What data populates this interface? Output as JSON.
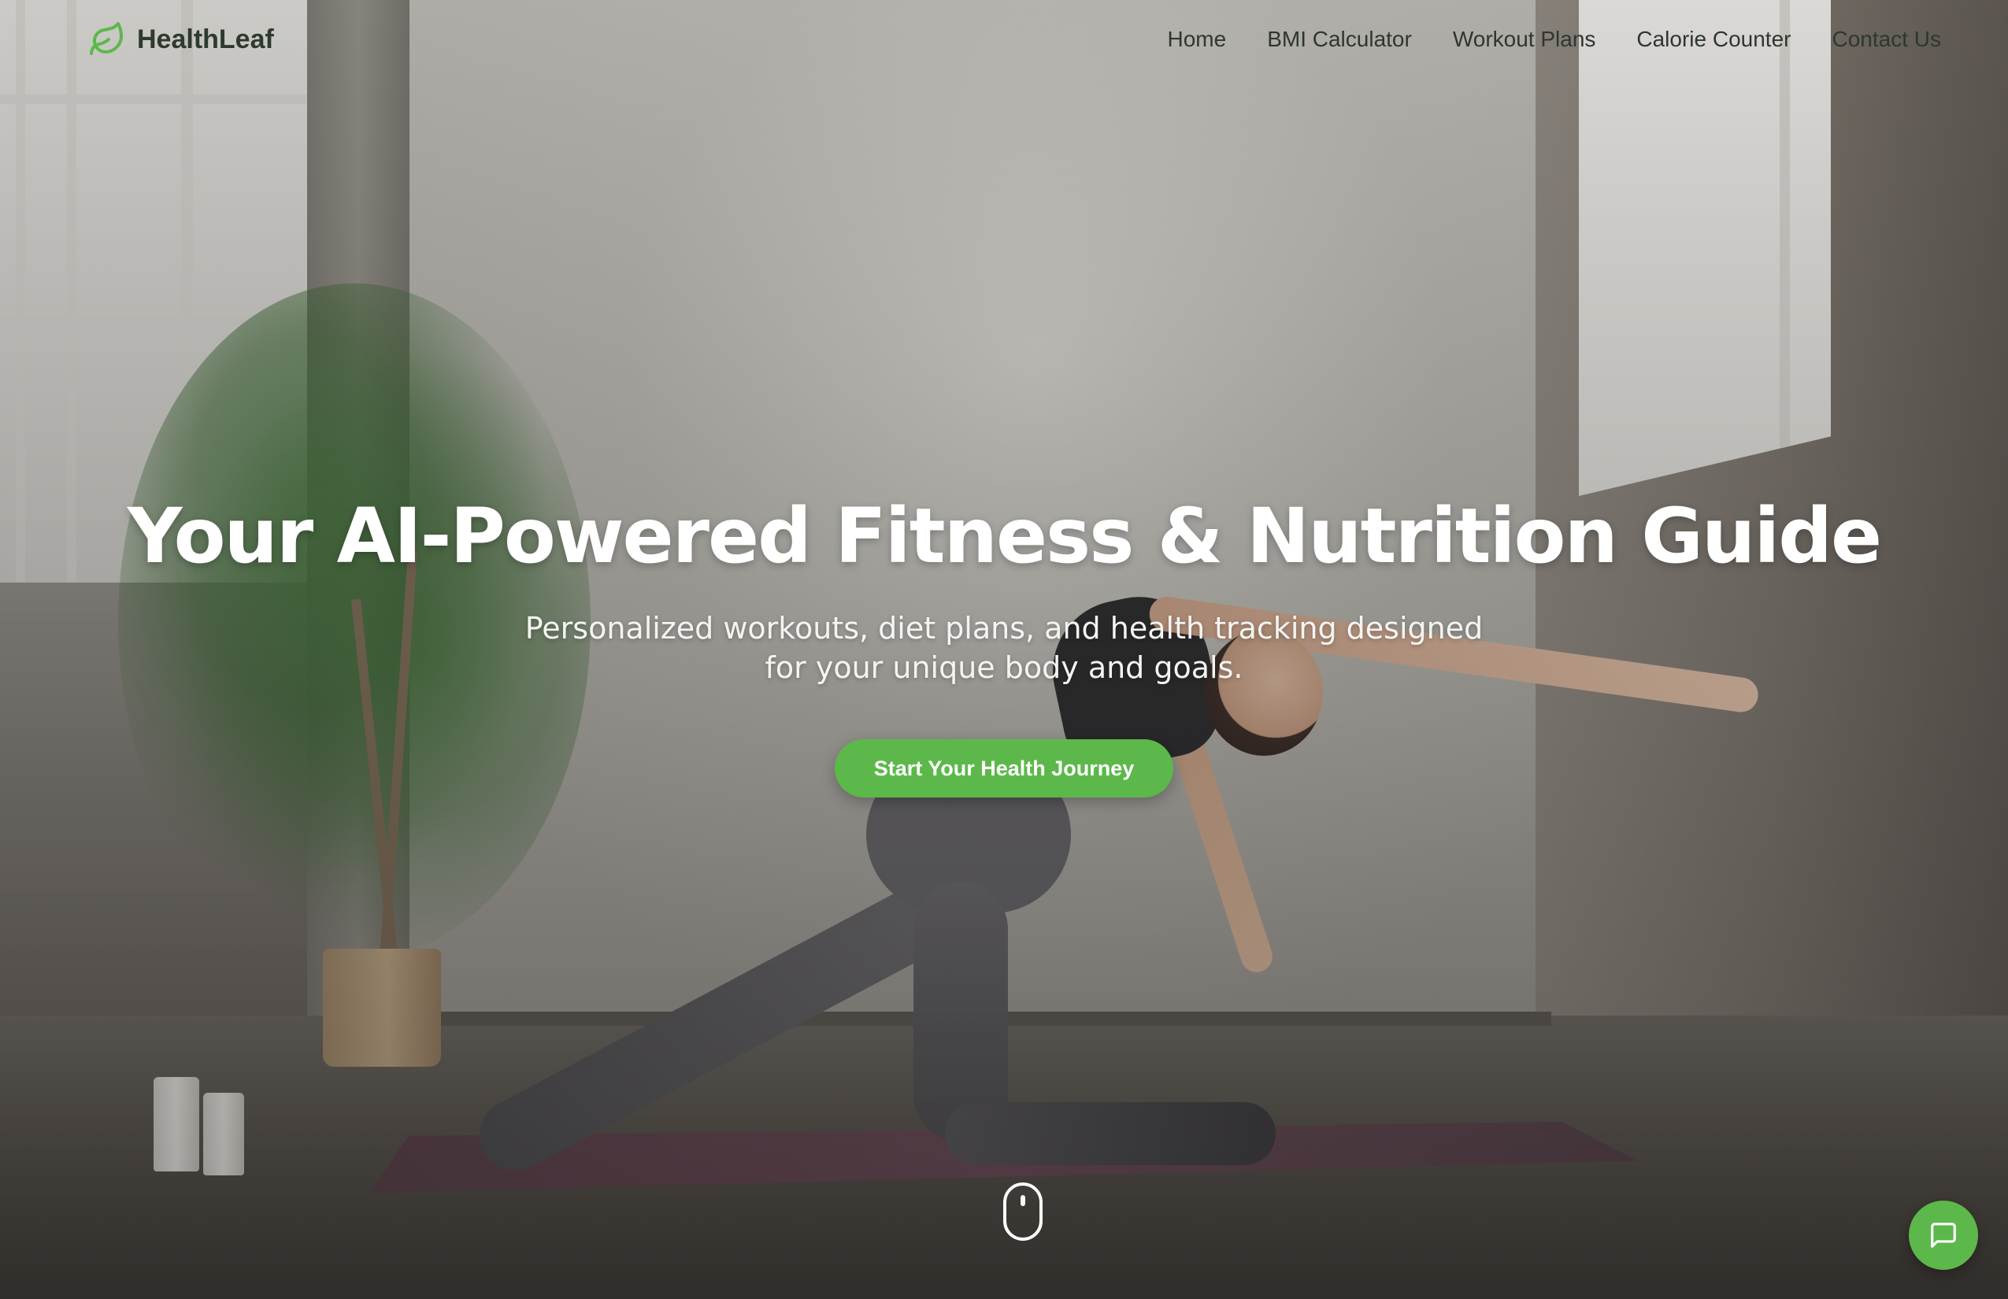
{
  "brand": {
    "name": "HealthLeaf",
    "icon": "leaf-icon",
    "color": "#5cb84a"
  },
  "nav": {
    "items": [
      {
        "label": "Home"
      },
      {
        "label": "BMI Calculator"
      },
      {
        "label": "Workout Plans"
      },
      {
        "label": "Calorie Counter"
      },
      {
        "label": "Contact Us"
      }
    ]
  },
  "hero": {
    "title": "Your AI-Powered Fitness & Nutrition Guide",
    "subtitle": "Personalized workouts, diet plans, and health tracking designed for your unique body and goals.",
    "cta_label": "Start Your Health Journey"
  },
  "scroll_indicator": {
    "icon": "mouse-scroll-icon"
  },
  "chat": {
    "icon": "chat-bubble-icon"
  },
  "colors": {
    "accent": "#5cb84a",
    "nav_text": "#2f3630",
    "hero_text": "#ffffff"
  }
}
